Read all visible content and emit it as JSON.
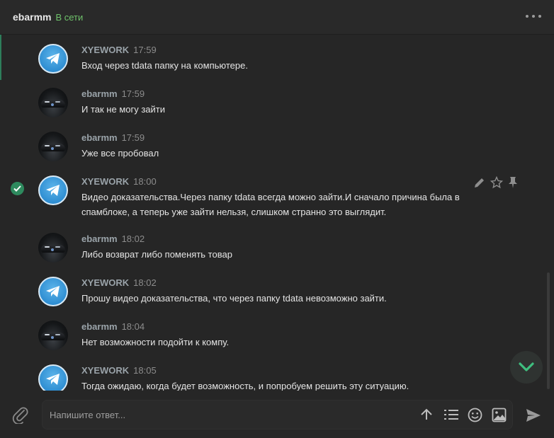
{
  "header": {
    "contact_name": "ebarmm",
    "status": "В сети",
    "more_icon": "more-dots-icon"
  },
  "messages": [
    {
      "author": "XYEWORK",
      "time": "17:59",
      "text": "Вход через tdata папку на компьютере.",
      "avatar": "telegram-logo"
    },
    {
      "author": "ebarmm",
      "time": "17:59",
      "text": "И так не могу зайти",
      "avatar": "car-photo"
    },
    {
      "author": "ebarmm",
      "time": "17:59",
      "text": "Уже все пробовал",
      "avatar": "car-photo"
    },
    {
      "author": "XYEWORK",
      "time": "18:00",
      "text": "Видео доказательства.Через папку tdata всегда можно зайти.И сначало причина была в спамблоке, а теперь уже зайти нельзя, слишком странно это выглядит.",
      "avatar": "telegram-logo",
      "selected": true,
      "actions": [
        "pencil-icon",
        "star-icon",
        "pin-icon"
      ]
    },
    {
      "author": "ebarmm",
      "time": "18:02",
      "text": "Либо возврат либо поменять товар",
      "avatar": "car-photo"
    },
    {
      "author": "XYEWORK",
      "time": "18:02",
      "text": "Прошу видео доказательства, что через папку tdata невозможно зайти.",
      "avatar": "telegram-logo"
    },
    {
      "author": "ebarmm",
      "time": "18:04",
      "text": "Нет возможности подойти к компу.",
      "avatar": "car-photo"
    },
    {
      "author": "XYEWORK",
      "time": "18:05",
      "text": "Тогда ожидаю, когда будет возможность, и попробуем решить эту ситуацию.",
      "avatar": "telegram-logo"
    }
  ],
  "composer": {
    "placeholder": "Напишите ответ...",
    "icons": [
      "paperclip-icon",
      "arrow-up-icon",
      "list-icon",
      "emoji-icon",
      "image-icon",
      "send-icon"
    ]
  },
  "colors": {
    "background": "#262626",
    "online": "#6fc26b",
    "accent_green": "#2e8a5e",
    "telegram_blue": "#2f8ed2"
  }
}
